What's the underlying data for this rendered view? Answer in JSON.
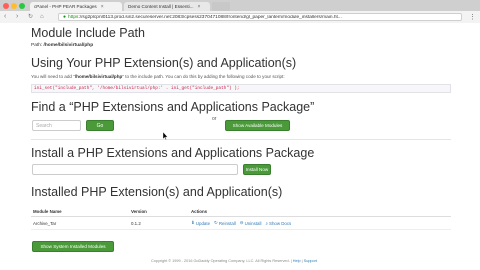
{
  "browser": {
    "tabs": [
      {
        "label": "cPanel - PHP PEAR Packages",
        "active": true
      },
      {
        "label": "Demo Content Install | Essenti...",
        "active": false
      }
    ],
    "url_scheme": "https",
    "url_rest": "://sg2plcpnl0113.prod.sin2.secureserver.net:2083/cpsess2370471088/frontend/gl_paper_lantern/module_installers/main.ht..."
  },
  "page": {
    "module_include_path_heading": "Module Include Path",
    "path_label": "Path: ",
    "path_value": "/home/bilsivirtual/php",
    "using_heading": "Using Your PHP Extension(s) and Application(s)",
    "note_prefix": "You will need to add \"",
    "note_path": "/home/bilsivirtual/php",
    "note_suffix": "\" to the include path. You can do this by adding the following code to your script:",
    "code": "ini_set(\"include_path\", '/home/bilsivirtual/php:' . ini_get(\"include_path\") );",
    "find_heading": "Find a “PHP Extensions and Applications Package”",
    "search_placeholder": "Search",
    "go_label": "Go",
    "or_label": "or",
    "show_available_label": "Show Available Modules",
    "install_heading": "Install a PHP Extensions and Applications Package",
    "install_now_label": "Install Now",
    "installed_heading": "Installed PHP Extension(s) and Application(s)",
    "table": {
      "headers": [
        "Module Name",
        "Version",
        "Actions"
      ],
      "rows": [
        {
          "name": "Archive_Tar",
          "version": "0.1.2",
          "actions": [
            "Update",
            "Reinstall",
            "Uninstall",
            "Show Docs"
          ]
        }
      ]
    },
    "show_system_label": "Show System Installed Modules",
    "footer_text": "Copyright © 1999 - 2016 GoDaddy Operating Company, LLC. All Rights Reserved. | ",
    "footer_link1": "Help",
    "footer_sep": " | ",
    "footer_link2": "Support"
  },
  "colors": {
    "green_button": "#4a9a3a",
    "link": "#337ab7",
    "code_text": "#c7254e"
  }
}
